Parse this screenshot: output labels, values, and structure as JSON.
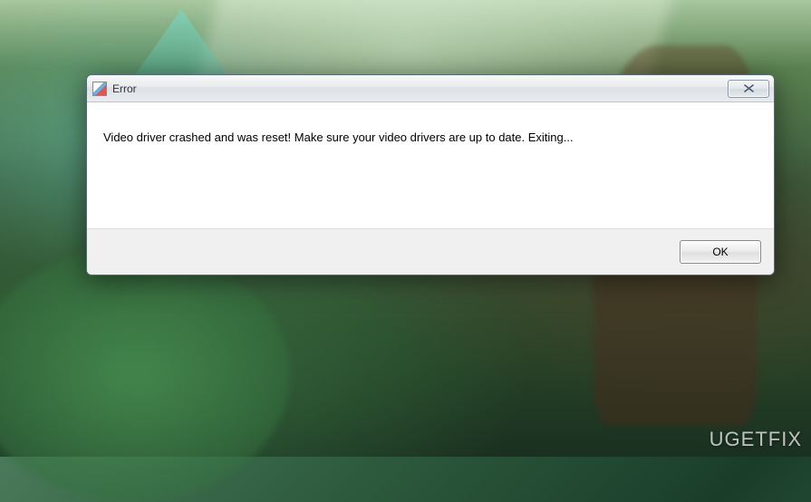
{
  "dialog": {
    "title": "Error",
    "message": "Video driver crashed and was reset!  Make sure your video drivers are up to date. Exiting...",
    "ok_label": "OK"
  },
  "watermark": {
    "text": "UGETFIX"
  }
}
